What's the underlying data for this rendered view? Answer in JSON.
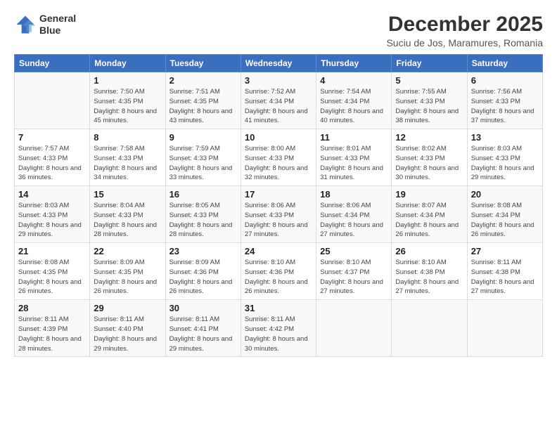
{
  "logo": {
    "line1": "General",
    "line2": "Blue"
  },
  "calendar": {
    "title": "December 2025",
    "subtitle": "Suciu de Jos, Maramures, Romania"
  },
  "headers": [
    "Sunday",
    "Monday",
    "Tuesday",
    "Wednesday",
    "Thursday",
    "Friday",
    "Saturday"
  ],
  "weeks": [
    [
      {
        "day": "",
        "info": ""
      },
      {
        "day": "1",
        "info": "Sunrise: 7:50 AM\nSunset: 4:35 PM\nDaylight: 8 hours\nand 45 minutes."
      },
      {
        "day": "2",
        "info": "Sunrise: 7:51 AM\nSunset: 4:35 PM\nDaylight: 8 hours\nand 43 minutes."
      },
      {
        "day": "3",
        "info": "Sunrise: 7:52 AM\nSunset: 4:34 PM\nDaylight: 8 hours\nand 41 minutes."
      },
      {
        "day": "4",
        "info": "Sunrise: 7:54 AM\nSunset: 4:34 PM\nDaylight: 8 hours\nand 40 minutes."
      },
      {
        "day": "5",
        "info": "Sunrise: 7:55 AM\nSunset: 4:33 PM\nDaylight: 8 hours\nand 38 minutes."
      },
      {
        "day": "6",
        "info": "Sunrise: 7:56 AM\nSunset: 4:33 PM\nDaylight: 8 hours\nand 37 minutes."
      }
    ],
    [
      {
        "day": "7",
        "info": "Sunrise: 7:57 AM\nSunset: 4:33 PM\nDaylight: 8 hours\nand 36 minutes."
      },
      {
        "day": "8",
        "info": "Sunrise: 7:58 AM\nSunset: 4:33 PM\nDaylight: 8 hours\nand 34 minutes."
      },
      {
        "day": "9",
        "info": "Sunrise: 7:59 AM\nSunset: 4:33 PM\nDaylight: 8 hours\nand 33 minutes."
      },
      {
        "day": "10",
        "info": "Sunrise: 8:00 AM\nSunset: 4:33 PM\nDaylight: 8 hours\nand 32 minutes."
      },
      {
        "day": "11",
        "info": "Sunrise: 8:01 AM\nSunset: 4:33 PM\nDaylight: 8 hours\nand 31 minutes."
      },
      {
        "day": "12",
        "info": "Sunrise: 8:02 AM\nSunset: 4:33 PM\nDaylight: 8 hours\nand 30 minutes."
      },
      {
        "day": "13",
        "info": "Sunrise: 8:03 AM\nSunset: 4:33 PM\nDaylight: 8 hours\nand 29 minutes."
      }
    ],
    [
      {
        "day": "14",
        "info": "Sunrise: 8:03 AM\nSunset: 4:33 PM\nDaylight: 8 hours\nand 29 minutes."
      },
      {
        "day": "15",
        "info": "Sunrise: 8:04 AM\nSunset: 4:33 PM\nDaylight: 8 hours\nand 28 minutes."
      },
      {
        "day": "16",
        "info": "Sunrise: 8:05 AM\nSunset: 4:33 PM\nDaylight: 8 hours\nand 28 minutes."
      },
      {
        "day": "17",
        "info": "Sunrise: 8:06 AM\nSunset: 4:33 PM\nDaylight: 8 hours\nand 27 minutes."
      },
      {
        "day": "18",
        "info": "Sunrise: 8:06 AM\nSunset: 4:34 PM\nDaylight: 8 hours\nand 27 minutes."
      },
      {
        "day": "19",
        "info": "Sunrise: 8:07 AM\nSunset: 4:34 PM\nDaylight: 8 hours\nand 26 minutes."
      },
      {
        "day": "20",
        "info": "Sunrise: 8:08 AM\nSunset: 4:34 PM\nDaylight: 8 hours\nand 26 minutes."
      }
    ],
    [
      {
        "day": "21",
        "info": "Sunrise: 8:08 AM\nSunset: 4:35 PM\nDaylight: 8 hours\nand 26 minutes."
      },
      {
        "day": "22",
        "info": "Sunrise: 8:09 AM\nSunset: 4:35 PM\nDaylight: 8 hours\nand 26 minutes."
      },
      {
        "day": "23",
        "info": "Sunrise: 8:09 AM\nSunset: 4:36 PM\nDaylight: 8 hours\nand 26 minutes."
      },
      {
        "day": "24",
        "info": "Sunrise: 8:10 AM\nSunset: 4:36 PM\nDaylight: 8 hours\nand 26 minutes."
      },
      {
        "day": "25",
        "info": "Sunrise: 8:10 AM\nSunset: 4:37 PM\nDaylight: 8 hours\nand 27 minutes."
      },
      {
        "day": "26",
        "info": "Sunrise: 8:10 AM\nSunset: 4:38 PM\nDaylight: 8 hours\nand 27 minutes."
      },
      {
        "day": "27",
        "info": "Sunrise: 8:11 AM\nSunset: 4:38 PM\nDaylight: 8 hours\nand 27 minutes."
      }
    ],
    [
      {
        "day": "28",
        "info": "Sunrise: 8:11 AM\nSunset: 4:39 PM\nDaylight: 8 hours\nand 28 minutes."
      },
      {
        "day": "29",
        "info": "Sunrise: 8:11 AM\nSunset: 4:40 PM\nDaylight: 8 hours\nand 29 minutes."
      },
      {
        "day": "30",
        "info": "Sunrise: 8:11 AM\nSunset: 4:41 PM\nDaylight: 8 hours\nand 29 minutes."
      },
      {
        "day": "31",
        "info": "Sunrise: 8:11 AM\nSunset: 4:42 PM\nDaylight: 8 hours\nand 30 minutes."
      },
      {
        "day": "",
        "info": ""
      },
      {
        "day": "",
        "info": ""
      },
      {
        "day": "",
        "info": ""
      }
    ]
  ]
}
